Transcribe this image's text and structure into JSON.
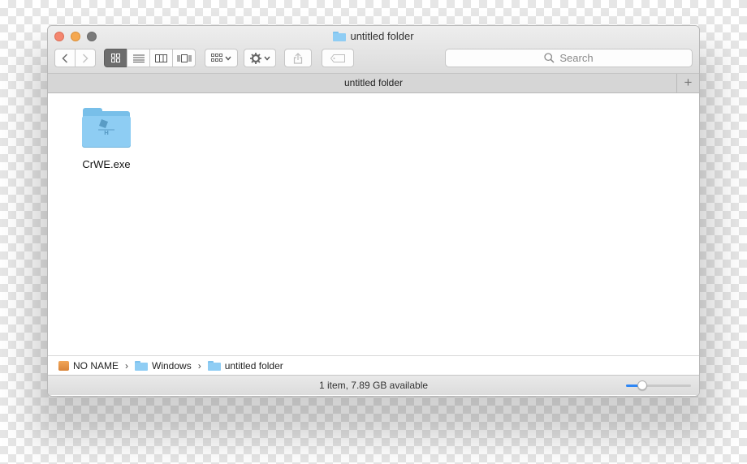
{
  "window": {
    "title": "untitled folder"
  },
  "toolbar": {
    "search_placeholder": "Search",
    "views": [
      "icon-view",
      "list-view",
      "column-view",
      "cover-flow-view"
    ],
    "active_view": "icon-view"
  },
  "tabbar": {
    "title": "untitled folder",
    "add_label": "+"
  },
  "content": {
    "items": [
      {
        "name": "CrWE.exe",
        "icon": "folder-icon"
      }
    ]
  },
  "pathbar": {
    "segments": [
      {
        "label": "NO NAME",
        "icon": "drive-icon"
      },
      {
        "label": "Windows",
        "icon": "folder-icon"
      },
      {
        "label": "untitled folder",
        "icon": "folder-icon"
      }
    ]
  },
  "statusbar": {
    "text": "1 item, 7.89 GB available",
    "icon_size_level": 0.25
  },
  "colors": {
    "accent": "#2f87f5",
    "folder": "#8ecdf3",
    "close": "#f4866f",
    "minimize": "#f5a850"
  }
}
